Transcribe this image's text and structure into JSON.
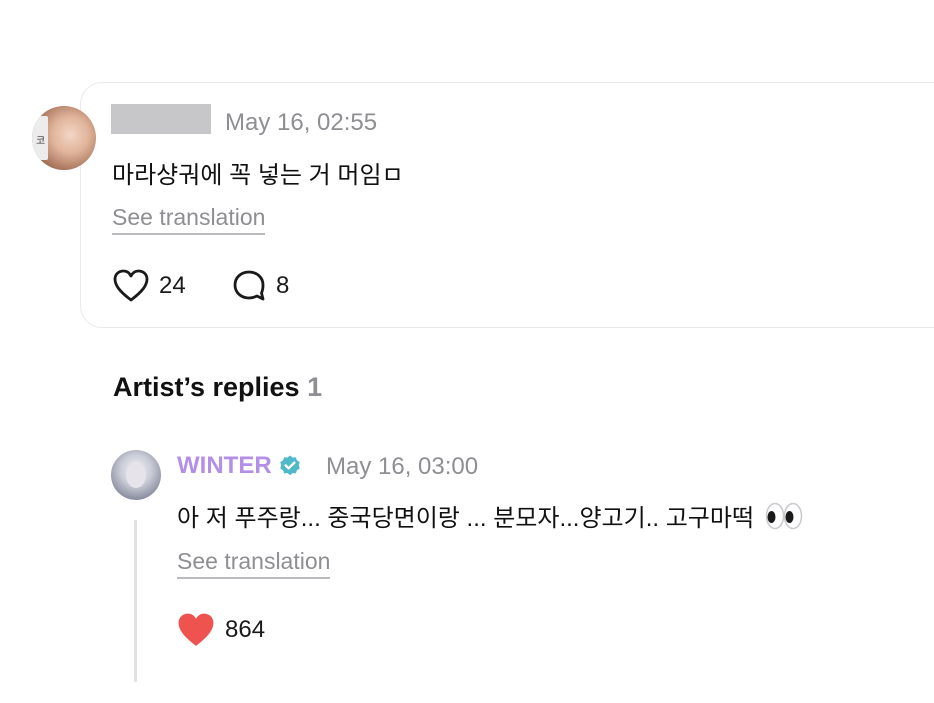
{
  "comment": {
    "author_name": "",
    "timestamp": "May 16, 02:55",
    "text": "마라샹궈에 꼭 넣는 거 머임ㅁ",
    "translate_label": "See translation",
    "like_count": "24",
    "reply_count": "8",
    "avatar_icon": "user-avatar",
    "avatar_side_text": "코"
  },
  "replies_section": {
    "heading": "Artist’s replies",
    "count": "1"
  },
  "artist_reply": {
    "author_name": "WINTER",
    "verified_icon": "verified-badge-icon",
    "timestamp": "May 16, 03:00",
    "text": "아 저 푸주랑... 중국당면이랑 ... 분모자...양고기.. 고구마떡",
    "emoji": "👀",
    "translate_label": "See translation",
    "like_count": "864",
    "liked": true,
    "like_color": "#ef5350",
    "name_color": "#b48fe8",
    "verified_color": "#4fb8c9"
  }
}
